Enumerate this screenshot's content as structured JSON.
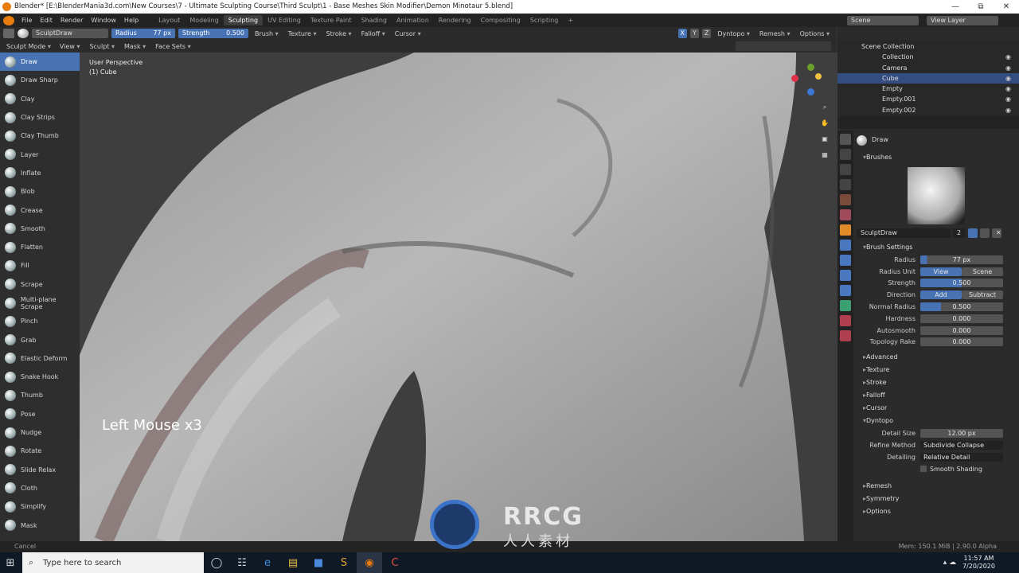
{
  "window": {
    "title": "Blender* [E:\\BlenderMania3d.com\\New Courses\\7 - Ultimate Sculpting Course\\Third Sculpt\\1 - Base Meshes Skin Modifier\\Demon Minotaur 5.blend]",
    "controls": [
      "—",
      "⧉",
      "✕"
    ]
  },
  "menu": [
    "File",
    "Edit",
    "Render",
    "Window",
    "Help"
  ],
  "workspaces": [
    "Layout",
    "Modeling",
    "Sculpting",
    "UV Editing",
    "Texture Paint",
    "Shading",
    "Animation",
    "Rendering",
    "Compositing",
    "Scripting"
  ],
  "active_workspace": "Sculpting",
  "scene": {
    "scene_name": "Scene",
    "view_layer": "View Layer"
  },
  "tool_header": {
    "brush_name": "SculptDraw",
    "radius_label": "Radius",
    "radius_value": "77 px",
    "strength_label": "Strength",
    "strength_value": "0.500",
    "menus": [
      "Brush",
      "Texture",
      "Stroke",
      "Falloff",
      "Cursor"
    ],
    "axes": [
      "X",
      "Y",
      "Z"
    ],
    "dyntopo": "Dyntopo",
    "remesh": "Remesh",
    "options": "Options"
  },
  "mode_header": {
    "mode": "Sculpt Mode",
    "menus": [
      "View",
      "Sculpt",
      "Mask",
      "Face Sets"
    ]
  },
  "tools": [
    "Draw",
    "Draw Sharp",
    "Clay",
    "Clay Strips",
    "Clay Thumb",
    "Layer",
    "Inflate",
    "Blob",
    "Crease",
    "Smooth",
    "Flatten",
    "Fill",
    "Scrape",
    "Multi-plane Scrape",
    "Pinch",
    "Grab",
    "Elastic Deform",
    "Snake Hook",
    "Thumb",
    "Pose",
    "Nudge",
    "Rotate",
    "Slide Relax",
    "Cloth",
    "Simplify",
    "Mask"
  ],
  "active_tool": "Draw",
  "viewport": {
    "view_name": "User Perspective",
    "object_name": "(1) Cube",
    "shortcut_overlay": "Left Mouse x3"
  },
  "outliner": {
    "root": "Scene Collection",
    "items": [
      "Collection",
      "Camera",
      "Cube",
      "Empty",
      "Empty.001",
      "Empty.002"
    ],
    "selected": "Cube"
  },
  "properties": {
    "brush_header": "Draw",
    "brushes_section": "Brushes",
    "brush_datablock": "SculptDraw",
    "brush_users": "2",
    "brush_settings_section": "Brush Settings",
    "rows": [
      {
        "label": "Radius",
        "value": "77 px",
        "fill": 0.08
      },
      {
        "label": "Radius Unit",
        "value": "View",
        "value2": "Scene"
      },
      {
        "label": "Strength",
        "value": "0.500",
        "fill": 0.5
      },
      {
        "label": "Direction",
        "value": "Add",
        "value2": "Subtract"
      },
      {
        "label": "Normal Radius",
        "value": "0.500",
        "fill": 0.25
      },
      {
        "label": "Hardness",
        "value": "0.000",
        "fill": 0
      },
      {
        "label": "Autosmooth",
        "value": "0.000",
        "fill": 0
      },
      {
        "label": "Topology Rake",
        "value": "0.000",
        "fill": 0
      }
    ],
    "subsections": [
      "Advanced",
      "Texture",
      "Stroke",
      "Falloff",
      "Cursor"
    ],
    "dyntopo_section": "Dyntopo",
    "dyntopo_rows": [
      {
        "label": "Detail Size",
        "value": "12.00 px"
      },
      {
        "label": "Refine Method",
        "value": "Subdivide Collapse"
      },
      {
        "label": "Detailing",
        "value": "Relative Detail"
      }
    ],
    "smooth_shading": "Smooth Shading",
    "bottom_sections": [
      "Remesh",
      "Symmetry",
      "Options"
    ]
  },
  "status": {
    "left": "Cancel",
    "right": "Mem: 150.1 MiB | 2.90.0 Alpha"
  },
  "taskbar": {
    "search_placeholder": "Type here to search",
    "time": "11:57 AM",
    "date": "7/20/2020"
  },
  "watermark": {
    "brand": "RRCG",
    "subtitle": "人人素材"
  }
}
